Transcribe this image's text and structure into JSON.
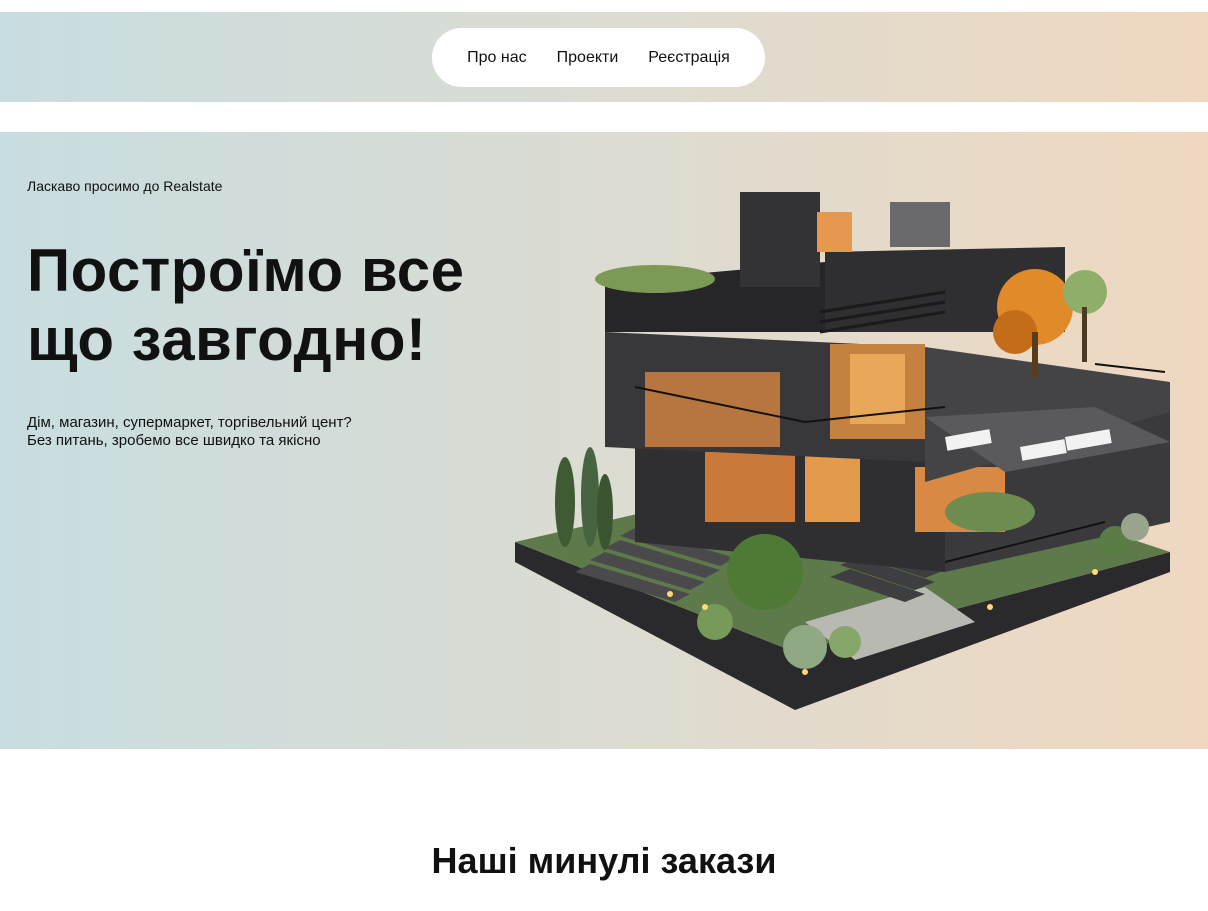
{
  "nav": {
    "items": [
      "Про нас",
      "Проекти",
      "Реєстрація"
    ]
  },
  "hero": {
    "welcome": "Ласкаво просимо до Realstate",
    "headline_line1": "Построїмо все",
    "headline_line2": "що завгодно!",
    "sub_line1": "Дім, магазин, супермаркет, торгівельний цент?",
    "sub_line2": "Без питань, зробемо все швидко та якісно"
  },
  "section": {
    "title": "Наші минулі закази"
  },
  "colors": {
    "gradient_left": "#c8dde0",
    "gradient_mid": "#dcdcd2",
    "gradient_right": "#f0d8c0"
  }
}
